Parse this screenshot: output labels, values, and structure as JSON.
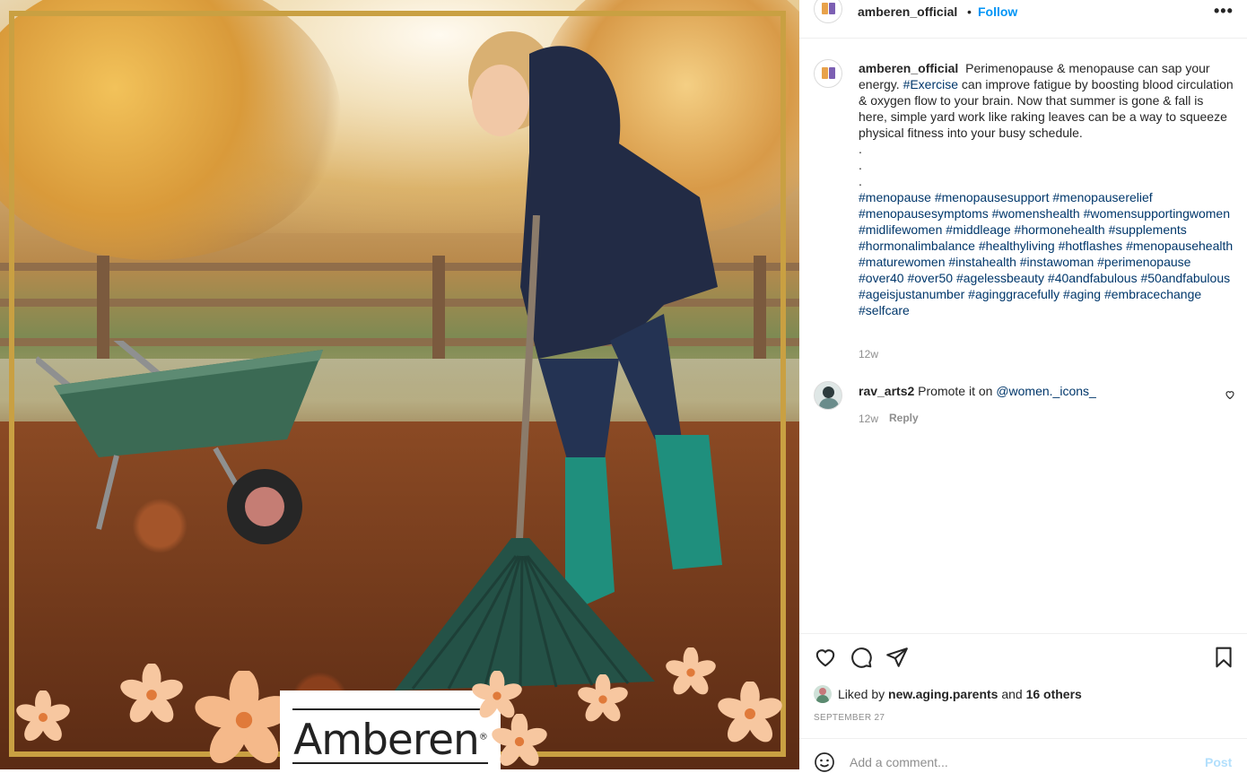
{
  "post": {
    "image_alt": "Woman raking autumn leaves next to a wheelbarrow",
    "brand_logo_text": "Amberen",
    "brand_logo_mark": "®"
  },
  "header": {
    "username": "amberen_official",
    "separator": "•",
    "follow_label": "Follow",
    "more_label": "•••"
  },
  "caption": {
    "username": "amberen_official",
    "text_before_tag": "Perimenopause & menopause can sap your energy.",
    "tag_exercise": "#Exercise",
    "text_after_tag": "can improve fatigue by boosting blood circulation & oxygen flow to your brain. Now that summer is gone & fall is here, simple yard work like raking leaves can be a way to squeeze physical fitness into your busy schedule.",
    "dot_lines": [
      ".",
      ".",
      "."
    ],
    "hashtags": "#menopause #menopausesupport #menopauserelief #menopausesymptoms #womenshealth #womensupportingwomen #midlifewomen #middleage #hormonehealth #supplements #hormonalimbalance #healthyliving #hotflashes #menopausehealth #maturewomen #instahealth #instawoman #perimenopause #over40 #over50 #agelessbeauty #40andfabulous #50andfabulous #ageisjustanumber #aginggracefully #aging #embracechange #selfcare",
    "time": "12w"
  },
  "comment": {
    "username": "rav_arts2",
    "text": "Promote it on",
    "mention": "@women._icons_",
    "time": "12w",
    "reply_label": "Reply"
  },
  "likes": {
    "prefix": "Liked by",
    "liker": "new.aging.parents",
    "joiner": "and",
    "others": "16 others"
  },
  "date": "SEPTEMBER 27",
  "add_comment": {
    "placeholder": "Add a comment...",
    "post_label": "Post"
  },
  "icons": {
    "like": "heart-icon",
    "comment": "speech-bubble-icon",
    "share": "paper-plane-icon",
    "save": "bookmark-icon",
    "emoji": "smiley-icon"
  },
  "colors": {
    "link": "#00376b",
    "follow": "#0095f6",
    "frame_gold": "#c9a042",
    "post_disabled": "#b2dffc"
  }
}
